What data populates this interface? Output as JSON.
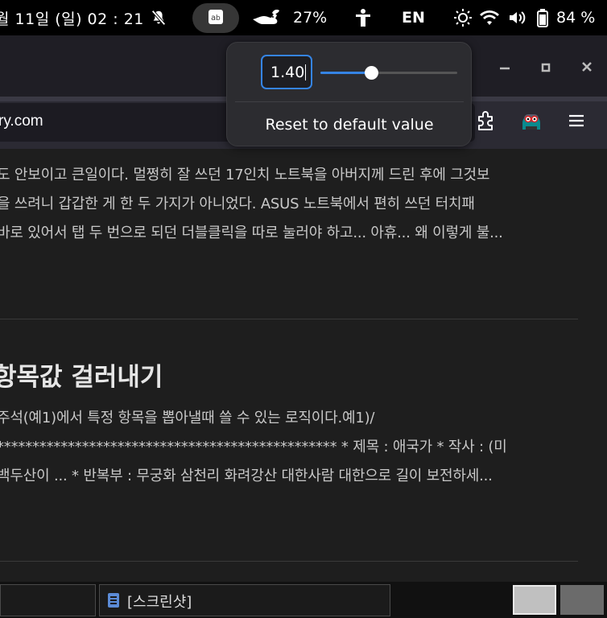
{
  "system_bar": {
    "clock": "월 11일 (일) 02 : 21",
    "battery_small": "27%",
    "language": "EN",
    "battery_main": "84 %",
    "icons": [
      "notifications-off-icon",
      "app-indicator-icon",
      "squirrel-icon",
      "accessibility-icon",
      "brightness-icon",
      "wifi-icon",
      "volume-icon",
      "battery-icon"
    ]
  },
  "browser": {
    "url_fragment": "ry.com",
    "window_controls": [
      "minimize-icon",
      "maximize-icon",
      "close-icon"
    ],
    "toolbar_icons": [
      "extensions-icon",
      "profile-avatar-icon",
      "menu-icon"
    ]
  },
  "zoom_popover": {
    "value": "1.40",
    "slider_fraction": 0.37,
    "reset_label": "Reset to default value"
  },
  "page": {
    "post1_lines": [
      "도 안보이고 큰일이다. 멀쩡히 잘 쓰던 17인치 노트북을 아버지께 드린 후에 그것보",
      "을 쓰려니 갑갑한 게 한 두 가지가 아니었다. ASUS 노트북에서 편히 쓰던 터치패",
      "바로 있어서 탭 두 번으로 되던 더블클릭을 따로 눌러야 하고... 아휴... 왜 이렇게 불..."
    ],
    "post2_title": "항목값 걸러내기",
    "post2_lines": [
      "주석(예1)에서 특정 항목을 뽑아낼때 쓸 수 있는 로직이다.예1)/",
      "************************************************ * 제목 : 애국가 * 작사 : (미",
      "백두산이 ... * 반복부 : 무궁화 삼천리 화려강산 대한사람 대한으로 길이 보전하세..."
    ]
  },
  "taskbar": {
    "window_label": "[스크린샷]",
    "workspace_icons": [
      "workspace-1",
      "workspace-2"
    ]
  },
  "colors": {
    "accent": "#3584e4",
    "page_bg": "#1e1e1e",
    "toolbar_bg": "#2b2a33"
  }
}
